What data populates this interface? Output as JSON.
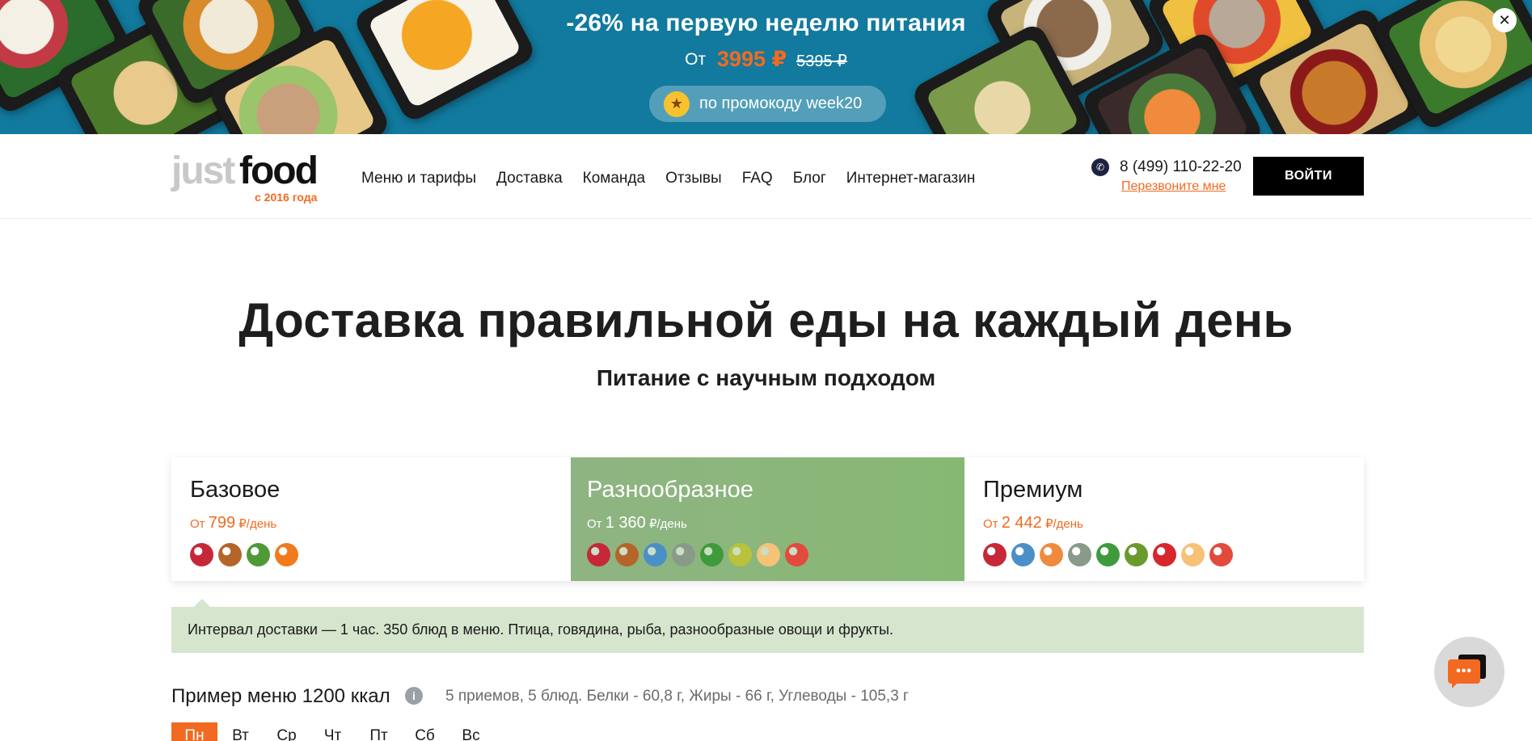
{
  "banner": {
    "title": "-26% на первую неделю питания",
    "price_prefix": "От",
    "price_new": "3995 ₽",
    "price_old": "5395 ₽",
    "promo_text": "по промокоду week20",
    "close_icon": "✕"
  },
  "header": {
    "logo_just": "just",
    "logo_food": "food",
    "logo_since": "с 2016 года",
    "nav": [
      "Меню и тарифы",
      "Доставка",
      "Команда",
      "Отзывы",
      "FAQ",
      "Блог",
      "Интернет-магазин"
    ],
    "phone": "8 (499) 110-22-20",
    "callback": "Перезвоните мне",
    "login": "ВОЙТИ"
  },
  "hero": {
    "title": "Доставка правильной еды на каждый день",
    "subtitle": "Питание с научным подходом"
  },
  "tariffs": [
    {
      "name": "Базовое",
      "price_prefix": "От",
      "price": "799",
      "price_unit": "₽/день",
      "icons": [
        "meat-icon",
        "chicken-leg-icon",
        "cucumber-icon",
        "carrot-icon"
      ],
      "icon_colors": [
        "#c6283a",
        "#b5652a",
        "#4f9a36",
        "#f07a1c"
      ]
    },
    {
      "name": "Разнообразное",
      "price_prefix": "От",
      "price": "1 360",
      "price_unit": "₽/день",
      "selected": true,
      "icons": [
        "meat-icon",
        "chicken-leg-icon",
        "fish-icon",
        "soup-icon",
        "salad-icon",
        "pear-icon",
        "cake-icon",
        "drink-icon"
      ],
      "icon_colors": [
        "#c6283a",
        "#b5652a",
        "#4b8fc8",
        "#8a9a8a",
        "#3f9a3c",
        "#b9c23b",
        "#f6c277",
        "#e24a3b"
      ]
    },
    {
      "name": "Премиум",
      "price_prefix": "От",
      "price": "2 442",
      "price_unit": "₽/день",
      "icons": [
        "meat-icon",
        "fish-icon",
        "shrimp-icon",
        "soup-icon",
        "salad-icon",
        "avocado-icon",
        "strawberry-icon",
        "cake-icon",
        "drink-icon"
      ],
      "icon_colors": [
        "#c6283a",
        "#4b8fc8",
        "#f08a3c",
        "#8a9a8a",
        "#3f9a3c",
        "#6b9a2c",
        "#d7262c",
        "#f6c277",
        "#e24a3b"
      ]
    }
  ],
  "info_bar": "Интервал доставки — 1 час. 350 блюд в меню. Птица, говядина, рыба, разнообразные овощи и фрукты.",
  "sample_menu": {
    "title": "Пример меню 1200 ккал",
    "info_icon": "i",
    "meta": "5 приемов, 5 блюд. Белки - 60,8 г, Жиры - 66 г, Углеводы - 105,3 г",
    "days": [
      "Пн",
      "Вт",
      "Ср",
      "Чт",
      "Пт",
      "Сб",
      "Вс"
    ],
    "active_day": "Пн"
  },
  "chat": {
    "dots": "•••"
  },
  "colors": {
    "accent": "#f26a21",
    "banner_bg": "#117a9e",
    "selected_tariff": "#8fb483",
    "info_bg": "#d6e5ce"
  }
}
